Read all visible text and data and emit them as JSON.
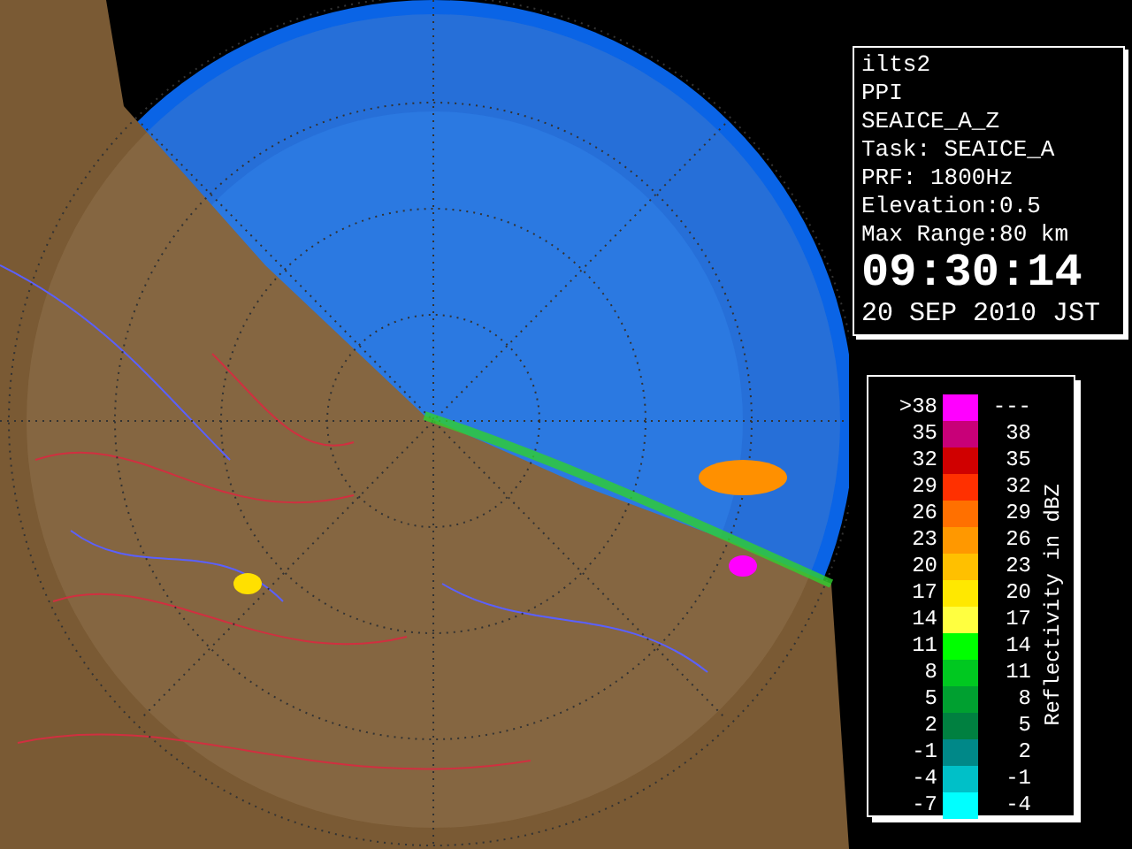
{
  "info": {
    "lines": [
      "ilts2",
      "PPI",
      "SEAICE_A_Z",
      "Task: SEAICE_A",
      "PRF: 1800Hz",
      "Elevation:0.5",
      "Max Range:80 km"
    ],
    "time": "09:30:14",
    "date": "20 SEP 2010 JST"
  },
  "legend": {
    "title": "Reflectivity in dBZ",
    "rows": [
      {
        "low": ">38",
        "high": "---",
        "color": "#ff00ff"
      },
      {
        "low": "35",
        "high": "38",
        "color": "#c80078"
      },
      {
        "low": "32",
        "high": "35",
        "color": "#d00000"
      },
      {
        "low": "29",
        "high": "32",
        "color": "#ff3000"
      },
      {
        "low": "26",
        "high": "29",
        "color": "#ff7000"
      },
      {
        "low": "23",
        "high": "26",
        "color": "#ff9800"
      },
      {
        "low": "20",
        "high": "23",
        "color": "#ffc000"
      },
      {
        "low": "17",
        "high": "20",
        "color": "#ffe800"
      },
      {
        "low": "14",
        "high": "17",
        "color": "#ffff40"
      },
      {
        "low": "11",
        "high": "14",
        "color": "#00ff00"
      },
      {
        "low": "8",
        "high": "11",
        "color": "#00c820"
      },
      {
        "low": "5",
        "high": "8",
        "color": "#00a030"
      },
      {
        "low": "2",
        "high": "5",
        "color": "#008040"
      },
      {
        "low": "-1",
        "high": "2",
        "color": "#008888"
      },
      {
        "low": "-4",
        "high": "-1",
        "color": "#00c0c8"
      },
      {
        "low": "-7",
        "high": "-4",
        "color": "#00ffff"
      }
    ]
  }
}
